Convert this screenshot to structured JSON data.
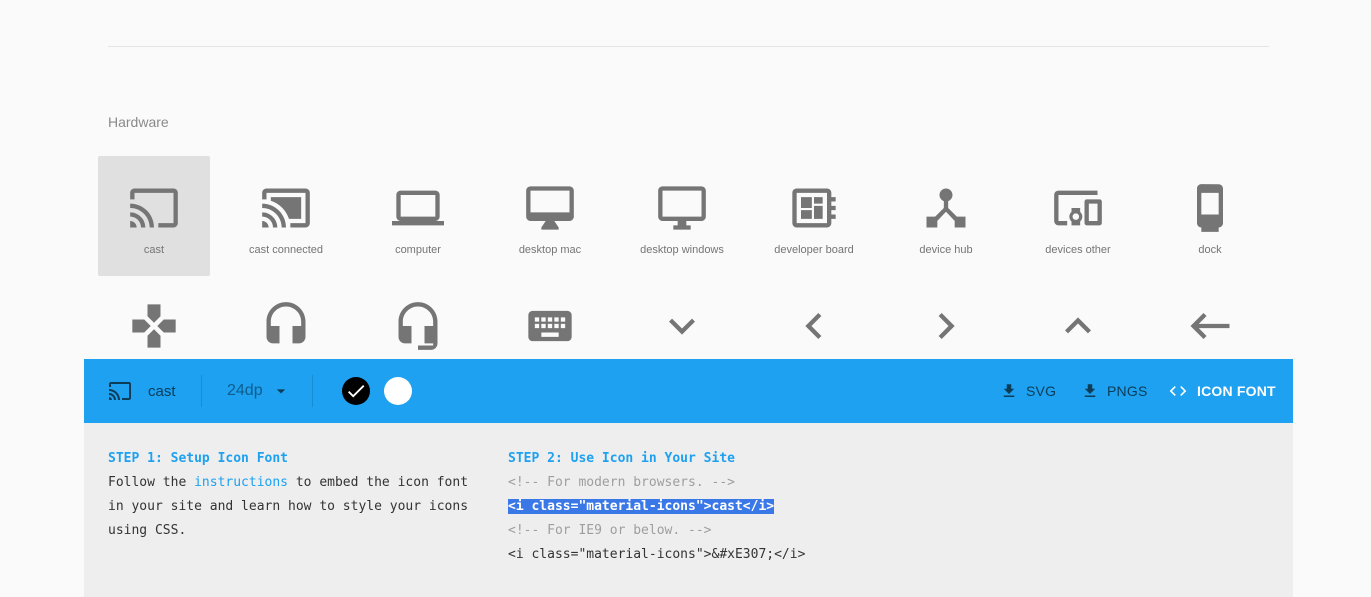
{
  "section": {
    "title": "Hardware"
  },
  "icons_row1": [
    {
      "label": "cast",
      "icon": "cast-icon",
      "selected": true
    },
    {
      "label": "cast connected",
      "icon": "cast-connected-icon"
    },
    {
      "label": "computer",
      "icon": "computer-icon"
    },
    {
      "label": "desktop mac",
      "icon": "desktop-mac-icon"
    },
    {
      "label": "desktop windows",
      "icon": "desktop-windows-icon"
    },
    {
      "label": "developer board",
      "icon": "developer-board-icon"
    },
    {
      "label": "device hub",
      "icon": "device-hub-icon"
    },
    {
      "label": "devices other",
      "icon": "devices-other-icon"
    },
    {
      "label": "dock",
      "icon": "dock-icon"
    }
  ],
  "icons_row2": [
    {
      "icon": "gamepad-icon"
    },
    {
      "icon": "headset-icon"
    },
    {
      "icon": "headset-mic-icon"
    },
    {
      "icon": "keyboard-icon"
    },
    {
      "icon": "keyboard-arrow-down-icon"
    },
    {
      "icon": "keyboard-arrow-left-icon"
    },
    {
      "icon": "keyboard-arrow-right-icon"
    },
    {
      "icon": "keyboard-arrow-up-icon"
    },
    {
      "icon": "keyboard-backspace-icon"
    }
  ],
  "toolbar": {
    "icon_name": "cast",
    "size": "24dp",
    "colors": {
      "toolbar": "#1da1f0",
      "dark_swatch": "#000000",
      "light_swatch": "#ffffff"
    },
    "svg_label": "SVG",
    "pngs_label": "PNGS",
    "iconfont_label": "ICON FONT"
  },
  "instructions": {
    "step1_title": "STEP 1: Setup Icon Font",
    "step1_text_a": "Follow the ",
    "step1_link": "instructions",
    "step1_text_b": " to embed the icon font",
    "step1_line2": "in your site and learn how to style your icons",
    "step1_line3": "using CSS.",
    "step2_title": "STEP 2: Use Icon in Your Site",
    "comment_modern": "<!-- For modern browsers. -->",
    "code_modern": "<i class=\"material-icons\">cast</i>",
    "comment_ie": "<!-- For IE9 or below. -->",
    "code_ie": "<i class=\"material-icons\">&#xE307;</i>"
  }
}
